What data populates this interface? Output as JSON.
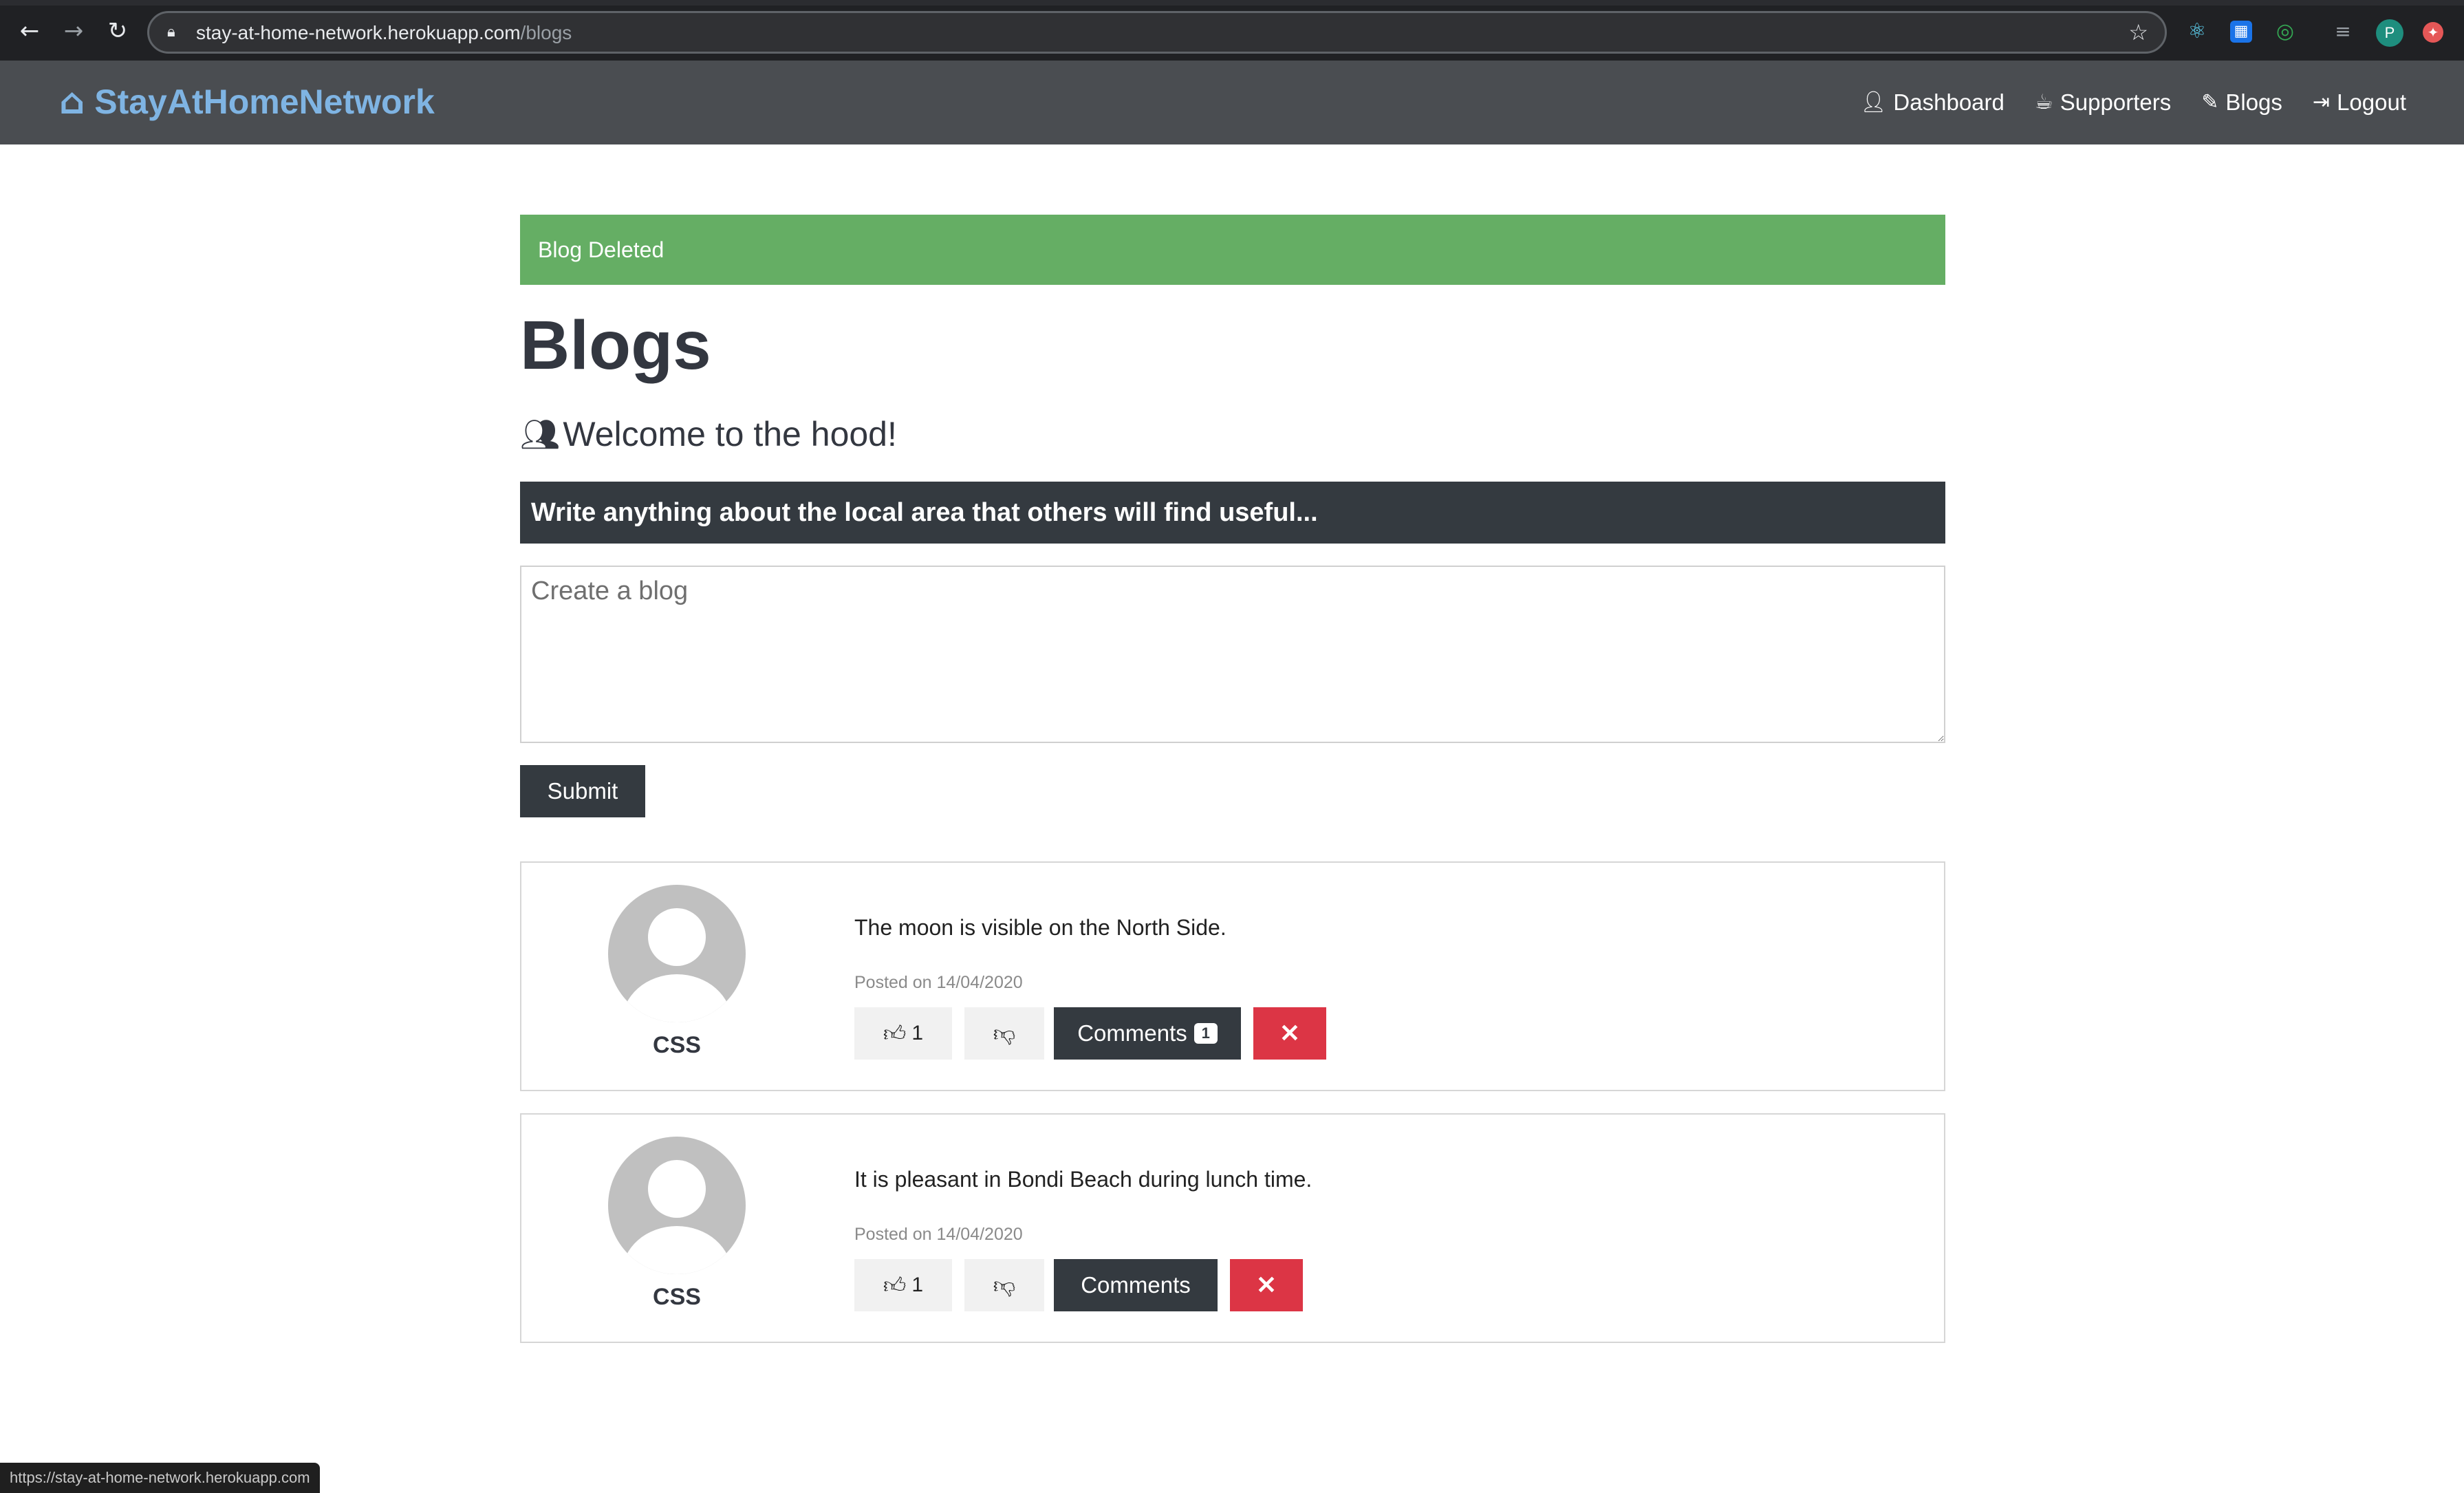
{
  "browser": {
    "url_domain": "stay-at-home-network.herokuapp.com",
    "url_path": "/blogs",
    "profile_initial": "P",
    "icons": [
      "back-arrow-icon",
      "forward-arrow-icon",
      "reload-icon",
      "lock-icon",
      "star-icon"
    ]
  },
  "navbar": {
    "brand": "StayAtHomeNetwork",
    "links": [
      {
        "label": "Dashboard",
        "icon": "user-icon"
      },
      {
        "label": "Supporters",
        "icon": "coffee-icon"
      },
      {
        "label": "Blogs",
        "icon": "blog-icon"
      },
      {
        "label": "Logout",
        "icon": "logout-icon"
      }
    ],
    "brand_color": "#7fb4e3",
    "background": "#4a4d51"
  },
  "alert": {
    "text": "Blog Deleted",
    "color": "#65ae64"
  },
  "page": {
    "title": "Blogs",
    "lead": "Welcome to the hood!",
    "banner": "Write anything about the local area that others will find useful...",
    "textarea_placeholder": "Create a blog",
    "submit_label": "Submit"
  },
  "posts": [
    {
      "user": "CSS",
      "text": "The moon is visible on the North Side.",
      "date": "Posted on 14/04/2020",
      "likes": "1",
      "comments_label": "Comments",
      "comments_count": "1",
      "delete_label": "✕"
    },
    {
      "user": "CSS",
      "text": "It is pleasant in Bondi Beach during lunch time.",
      "date": "Posted on 14/04/2020",
      "likes": "1",
      "comments_label": "Comments",
      "comments_count": "",
      "delete_label": "✕"
    }
  ],
  "statusbar": {
    "text": "https://stay-at-home-network.herokuapp.com"
  },
  "colors": {
    "danger": "#dc3545",
    "dark": "#343a40"
  }
}
